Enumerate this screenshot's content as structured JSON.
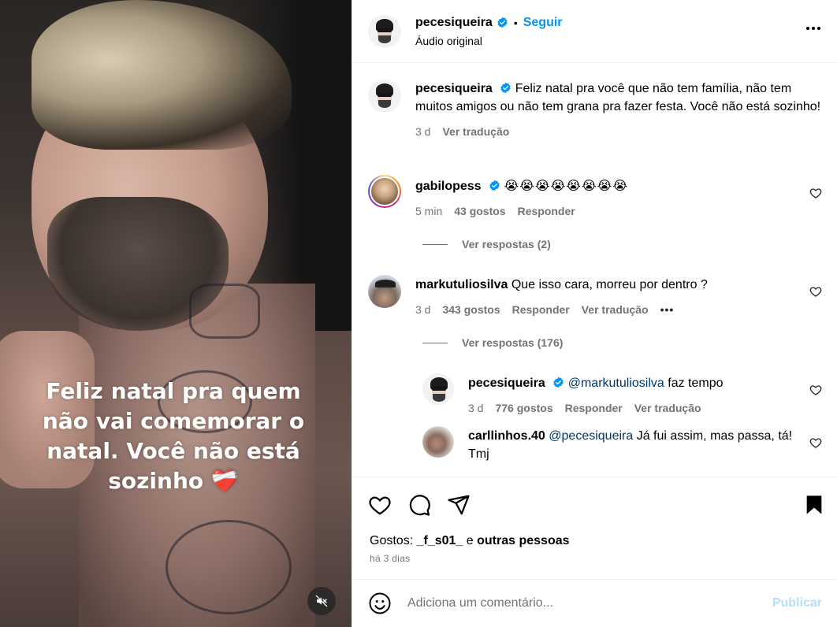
{
  "media": {
    "overlay_lines": [
      "Feliz natal pra quem",
      "não vai comemorar o",
      "natal. Você não está",
      "sozinho ❤️‍🩹"
    ]
  },
  "header": {
    "username": "pecesiqueira",
    "separator": "•",
    "follow_label": "Seguir",
    "subtitle": "Áudio original"
  },
  "caption": {
    "username": "pecesiqueira",
    "text": "Feliz natal pra você que não tem família, não tem muitos amigos ou não tem grana pra fazer festa. Você não está sozinho!",
    "time": "3 d",
    "translate": "Ver tradução"
  },
  "comments": [
    {
      "username": "gabilopess",
      "text": "😭😭😭😭😭😭😭😭",
      "time": "5 min",
      "likes": "43 gostos",
      "reply": "Responder",
      "view_replies": "Ver respostas (2)"
    },
    {
      "username": "markutuliosilva",
      "text": "Que isso cara, morreu por dentro ?",
      "time": "3 d",
      "likes": "343 gostos",
      "reply": "Responder",
      "translate": "Ver tradução",
      "more": "•••",
      "view_replies": "Ver respostas (176)"
    }
  ],
  "replies": [
    {
      "username": "pecesiqueira",
      "mention": "@markutuliosilva",
      "text": "faz tempo",
      "time": "3 d",
      "likes": "776 gostos",
      "reply": "Responder",
      "translate": "Ver tradução"
    },
    {
      "username": "carllinhos.40",
      "mention": "@pecesiqueira",
      "text": "Já fui assim, mas passa, tá! Tmj"
    }
  ],
  "likes": {
    "prefix": "Gostos:",
    "user": "_f_s01_",
    "conj": "e",
    "others": "outras pessoas",
    "ago": "há 3 dias"
  },
  "add_comment": {
    "placeholder": "Adiciona um comentário...",
    "publish": "Publicar"
  },
  "colors": {
    "accent": "#0095f6",
    "muted": "#737373",
    "publish_disabled": "#b2dffc"
  }
}
